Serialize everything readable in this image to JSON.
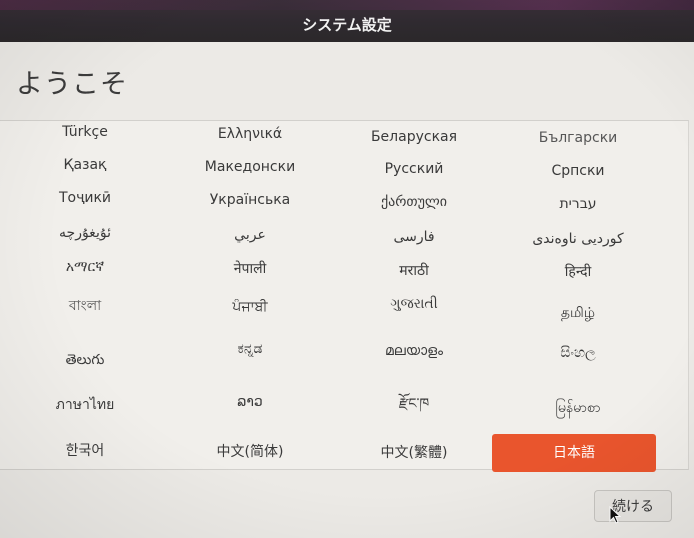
{
  "window": {
    "title": "システム設定"
  },
  "page": {
    "heading": "ようこそ"
  },
  "languages": [
    "Türkçe",
    "Ελληνικά",
    "Беларуская",
    "Български",
    "Қазақ",
    "Македонски",
    "Русский",
    "Српски",
    "Тоҷикӣ",
    "Українська",
    "ქართული",
    "עברית",
    "ئۇيغۇرچە",
    "عربي",
    "فارسی",
    "کوردیی ناوەندی",
    "አማርኛ",
    "नेपाली",
    "मराठी",
    "हिन्दी",
    "বাংলা",
    "ਪੰਜਾਬੀ",
    "ગુજરાતી",
    "தமிழ்",
    "తెలుగు",
    "ಕನ್ನಡ",
    "മലയാളം",
    "සිංහල",
    "ภาษาไทย",
    "ລາວ",
    "རྫོང་ཁ",
    "မြန်မာစာ",
    "한국어",
    "中文(简体)",
    "中文(繁體)",
    "日本語"
  ],
  "selected_language": "日本語",
  "buttons": {
    "continue": "続ける"
  },
  "colors": {
    "accent": "#e9552d",
    "titlebar": "#2f2a30"
  }
}
